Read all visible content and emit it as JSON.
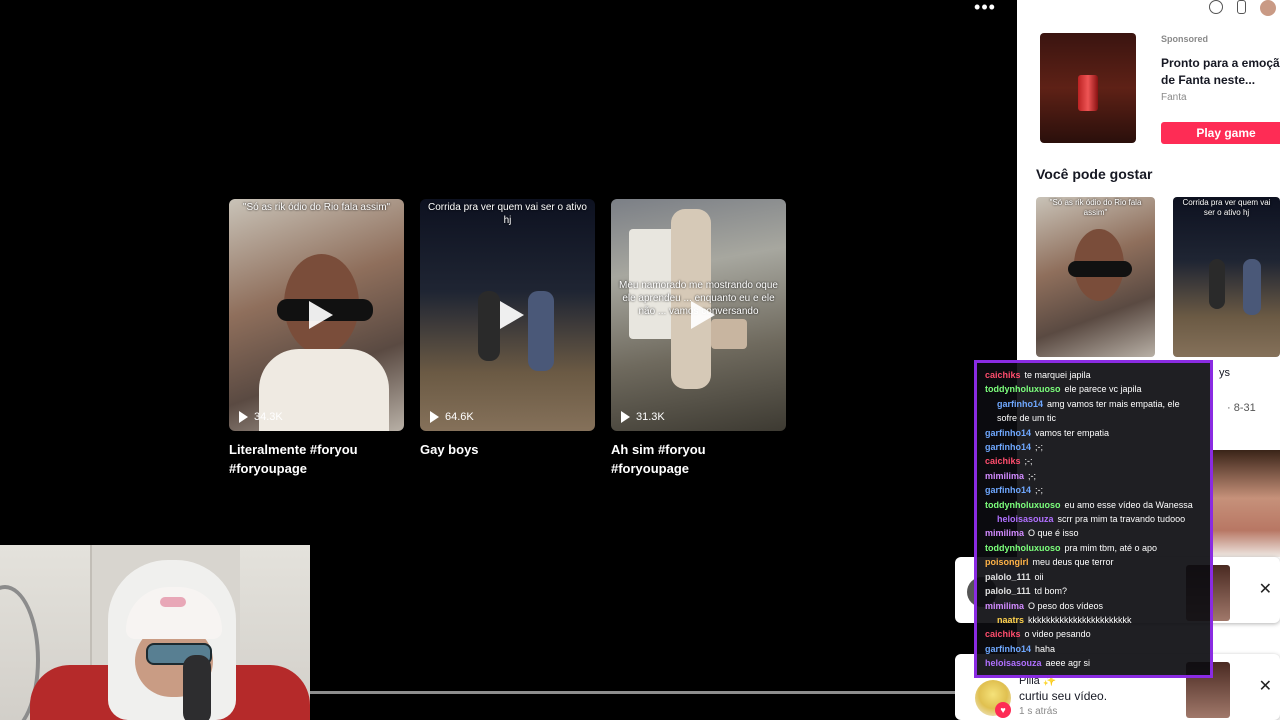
{
  "player": {
    "more_label": "•••"
  },
  "videos": [
    {
      "caption": "\"Só as rik ódio do Rio fala assim\"",
      "views": "34.3K",
      "title": "Literalmente #foryou #foryoupage"
    },
    {
      "caption": "Corrida pra ver quem vai ser o ativo hj",
      "views": "64.6K",
      "title": "Gay boys"
    },
    {
      "caption": "Meu namorado me mostrando oque ele aprendeu ... enquanto eu e ele não ... vamos conversando",
      "views": "31.3K",
      "title": "Ah sim #foryou #foryoupage"
    }
  ],
  "sidebar": {
    "ad": {
      "sponsored": "Sponsored",
      "title_line1": "Pronto para a emoção",
      "title_line2": "de Fanta neste...",
      "brand": "Fanta",
      "cta": "Play game"
    },
    "rec_heading": "Você pode gostar",
    "rec": [
      {
        "caption": "\"Só as rik ódio do Rio fala assim\""
      },
      {
        "caption": "Corrida pra ver quem vai ser o ativo hj"
      }
    ],
    "rec_extra_title": "ys",
    "rec_extra_date": "· 8-31"
  },
  "notifications": [
    {
      "name": "",
      "msg": "",
      "time": ""
    },
    {
      "name": "Pilla ✨",
      "msg": "curtiu seu vídeo.",
      "time": "1 s atrás"
    }
  ],
  "chat": [
    {
      "user": "caichiks",
      "color": "#ff4d6d",
      "text": "te marquei japila",
      "indent": false
    },
    {
      "user": "toddynholuxuoso",
      "color": "#7cff7c",
      "text": "ele parece vc japila",
      "indent": false
    },
    {
      "user": "garfinho14",
      "color": "#6fa8ff",
      "text": "amg vamos ter mais empatia, ele sofre de um tic",
      "indent": true
    },
    {
      "user": "garfinho14",
      "color": "#6fa8ff",
      "text": "vamos ter empatia",
      "indent": false
    },
    {
      "user": "garfinho14",
      "color": "#6fa8ff",
      "text": ";-;",
      "indent": false
    },
    {
      "user": "caichiks",
      "color": "#ff4d6d",
      "text": ";-;",
      "indent": false
    },
    {
      "user": "mimilima",
      "color": "#d28bff",
      "text": ";-;",
      "indent": false
    },
    {
      "user": "garfinho14",
      "color": "#6fa8ff",
      "text": ";-;",
      "indent": false
    },
    {
      "user": "toddynholuxuoso",
      "color": "#7cff7c",
      "text": "eu amo esse vídeo da Wanessa",
      "indent": false
    },
    {
      "user": "heloisasouza",
      "color": "#b070ff",
      "text": "scrr pra mim ta travando tudooo",
      "indent": true
    },
    {
      "user": "mimilima",
      "color": "#d28bff",
      "text": "O que é isso",
      "indent": false
    },
    {
      "user": "toddynholuxuoso",
      "color": "#7cff7c",
      "text": "pra mim tbm, até o apo",
      "indent": false
    },
    {
      "user": "poisongirl",
      "color": "#ffb347",
      "text": "meu deus que terror",
      "indent": false
    },
    {
      "user": "palolo_111",
      "color": "#e0e0e0",
      "text": "oii",
      "indent": false
    },
    {
      "user": "palolo_111",
      "color": "#e0e0e0",
      "text": "td bom?",
      "indent": false
    },
    {
      "user": "mimilima",
      "color": "#d28bff",
      "text": "O peso dos vídeos",
      "indent": false
    },
    {
      "user": "naatrs",
      "color": "#ffd24d",
      "text": "kkkkkkkkkkkkkkkkkkkkkkk",
      "indent": true
    },
    {
      "user": "caichiks",
      "color": "#ff4d6d",
      "text": "o video pesando",
      "indent": false
    },
    {
      "user": "garfinho14",
      "color": "#6fa8ff",
      "text": "haha",
      "indent": false
    },
    {
      "user": "heloisasouza",
      "color": "#b070ff",
      "text": "aeee agr si",
      "indent": false
    }
  ],
  "colors": {
    "chat_border": "#8a2be2",
    "cta": "#fe2c55"
  },
  "icons": [
    "more-icon",
    "play-icon",
    "close-icon",
    "heart-icon",
    "phone-icon",
    "explore-icon"
  ]
}
